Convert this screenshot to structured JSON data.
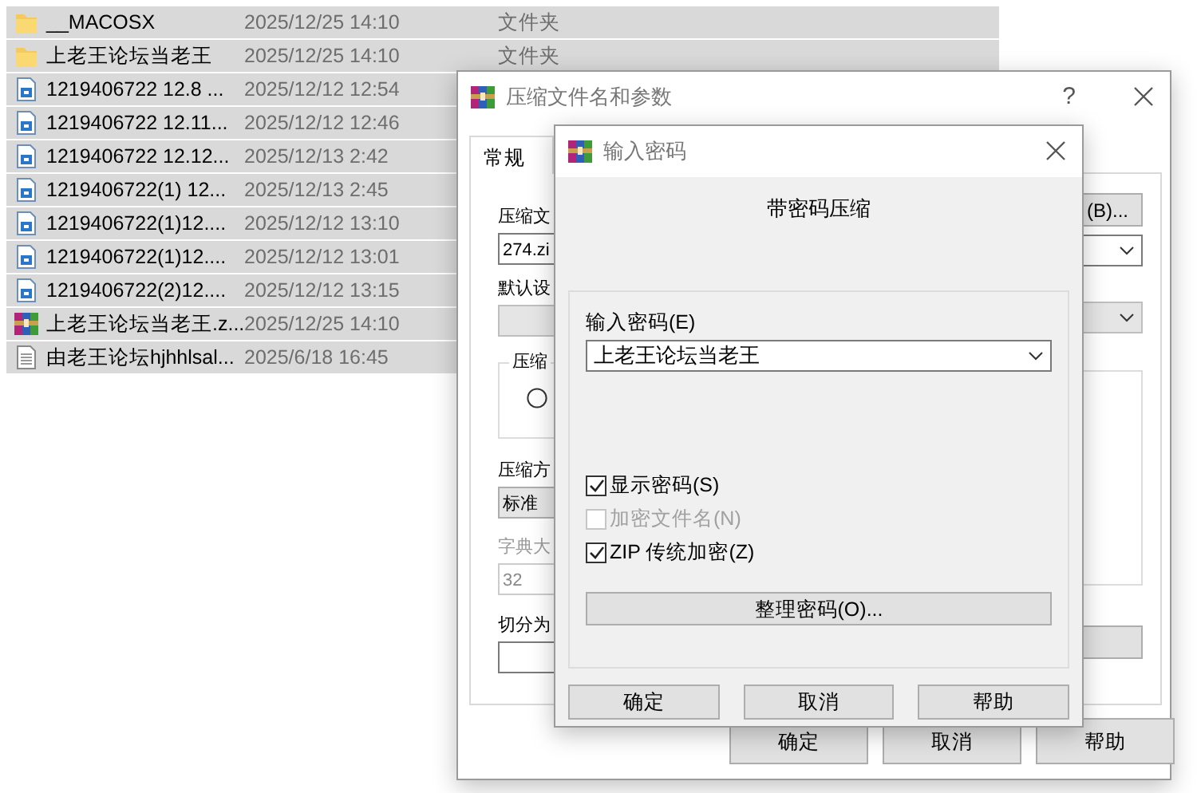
{
  "file_list": {
    "rows": [
      {
        "kind": "folder",
        "name": "__MACOSX",
        "date": "2025/12/25 14:10",
        "type": "文件夹",
        "selected": true
      },
      {
        "kind": "folder",
        "name": "上老王论坛当老王",
        "date": "2025/12/25 14:10",
        "type": "文件夹",
        "selected": true
      },
      {
        "kind": "document",
        "name": "1219406722 12.8 ...",
        "date": "2025/12/12 12:54",
        "selected": true
      },
      {
        "kind": "document",
        "name": "1219406722 12.11...",
        "date": "2025/12/12 12:46",
        "selected": true
      },
      {
        "kind": "document",
        "name": "1219406722 12.12...",
        "date": "2025/12/13 2:42",
        "selected": true
      },
      {
        "kind": "document",
        "name": "1219406722(1) 12...",
        "date": "2025/12/13 2:45",
        "selected": true
      },
      {
        "kind": "document",
        "name": "1219406722(1)12....",
        "date": "2025/12/12 13:10",
        "selected": true
      },
      {
        "kind": "document",
        "name": "1219406722(1)12....",
        "date": "2025/12/12 13:01",
        "selected": true
      },
      {
        "kind": "document",
        "name": "1219406722(2)12....",
        "date": "2025/12/12 13:15",
        "selected": true
      },
      {
        "kind": "archive",
        "name": "上老王论坛当老王.z...",
        "date": "2025/12/25 14:10",
        "selected": true
      },
      {
        "kind": "text",
        "name": "由老王论坛hjhhlsal...",
        "date": "2025/6/18 16:45",
        "selected": true
      }
    ]
  },
  "compress_dialog": {
    "title": "压缩文件名和参数",
    "help_button": "?",
    "tab": {
      "label": "常规",
      "selected": true
    },
    "archive_name_label": "压缩文",
    "archive_name": "274.zi",
    "browse_button": "(B)...",
    "profile_label": "默认设",
    "format_group_label": "压缩",
    "format_option": {
      "selected": false
    },
    "method_label": "压缩方",
    "method": "标准",
    "dictionary_label": "字典大",
    "dictionary": "32",
    "split_label": "切分为",
    "buttons": [
      "确定",
      "取消",
      "帮助"
    ]
  },
  "password_dialog": {
    "title": "输入密码",
    "heading": "带密码压缩",
    "password_label": "输入密码(E)",
    "password": "上老王论坛当老王",
    "options": [
      {
        "label": "显示密码(S)",
        "checked": true,
        "disabled": false
      },
      {
        "label": "加密文件名(N)",
        "checked": false,
        "disabled": true
      },
      {
        "label": "ZIP 传统加密(Z)",
        "checked": true,
        "disabled": false
      }
    ],
    "organize_button": "整理密码(O)...",
    "buttons": [
      "确定",
      "取消",
      "帮助"
    ]
  }
}
